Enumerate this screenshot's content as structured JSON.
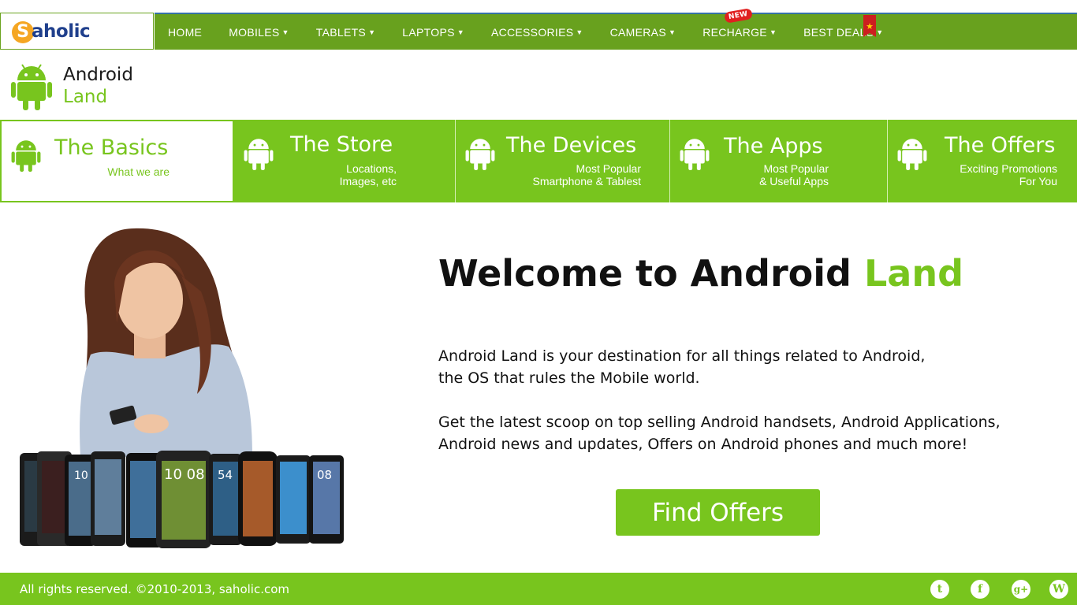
{
  "logo": {
    "letter": "S",
    "text": "aholic"
  },
  "nav": {
    "items": [
      {
        "label": "HOME",
        "caret": ""
      },
      {
        "label": "MOBILES",
        "caret": "▼"
      },
      {
        "label": "TABLETS",
        "caret": "▼"
      },
      {
        "label": "LAPTOPS",
        "caret": "▼"
      },
      {
        "label": "ACCESSORIES",
        "caret": "▼"
      },
      {
        "label": "CAMERAS",
        "caret": "▼"
      },
      {
        "label": "RECHARGE",
        "caret": "▼"
      },
      {
        "label": "BEST DEALS",
        "caret": "▼"
      }
    ],
    "new_badge": "NEW",
    "ribbon_star": "★"
  },
  "brand": {
    "line1": "Android",
    "line2": "Land"
  },
  "tabs": [
    {
      "title": "The Basics",
      "sub1": "What we are",
      "sub2": ""
    },
    {
      "title": "The Store",
      "sub1": "Locations,",
      "sub2": "Images, etc"
    },
    {
      "title": "The Devices",
      "sub1": "Most Popular",
      "sub2": "Smartphone & Tablest"
    },
    {
      "title": "The Apps",
      "sub1": "Most Popular",
      "sub2": "& Useful Apps"
    },
    {
      "title": "The Offers",
      "sub1": "Exciting Promotions",
      "sub2": "For You"
    }
  ],
  "welcome": {
    "part1": "Welcome to Android ",
    "part2": "Land"
  },
  "paragraphs": {
    "p1l1": "Android Land is your destination for all things related to Android,",
    "p1l2": "the OS that rules the Mobile world.",
    "p2l1": "Get the latest scoop on top selling Android handsets, Android Applications,",
    "p2l2": "Android news and updates, Offers on Android phones and much more!"
  },
  "cta": {
    "label": "Find Offers"
  },
  "footer": {
    "copyright": "All rights reserved. ©2010-2013, saholic.com",
    "social": [
      {
        "icon": "twitter-icon",
        "glyph": "t"
      },
      {
        "icon": "facebook-icon",
        "glyph": "f"
      },
      {
        "icon": "google-plus-icon",
        "glyph": "g+"
      },
      {
        "icon": "wikipedia-icon",
        "glyph": "W"
      }
    ]
  },
  "phone_screens": [
    "10",
    "10",
    "10 08",
    "54",
    "08"
  ],
  "colors": {
    "accent": "#78c51e",
    "nav": "#68a11e",
    "brand_blue": "#1f3f8c",
    "logo_orange": "#f5a623"
  }
}
